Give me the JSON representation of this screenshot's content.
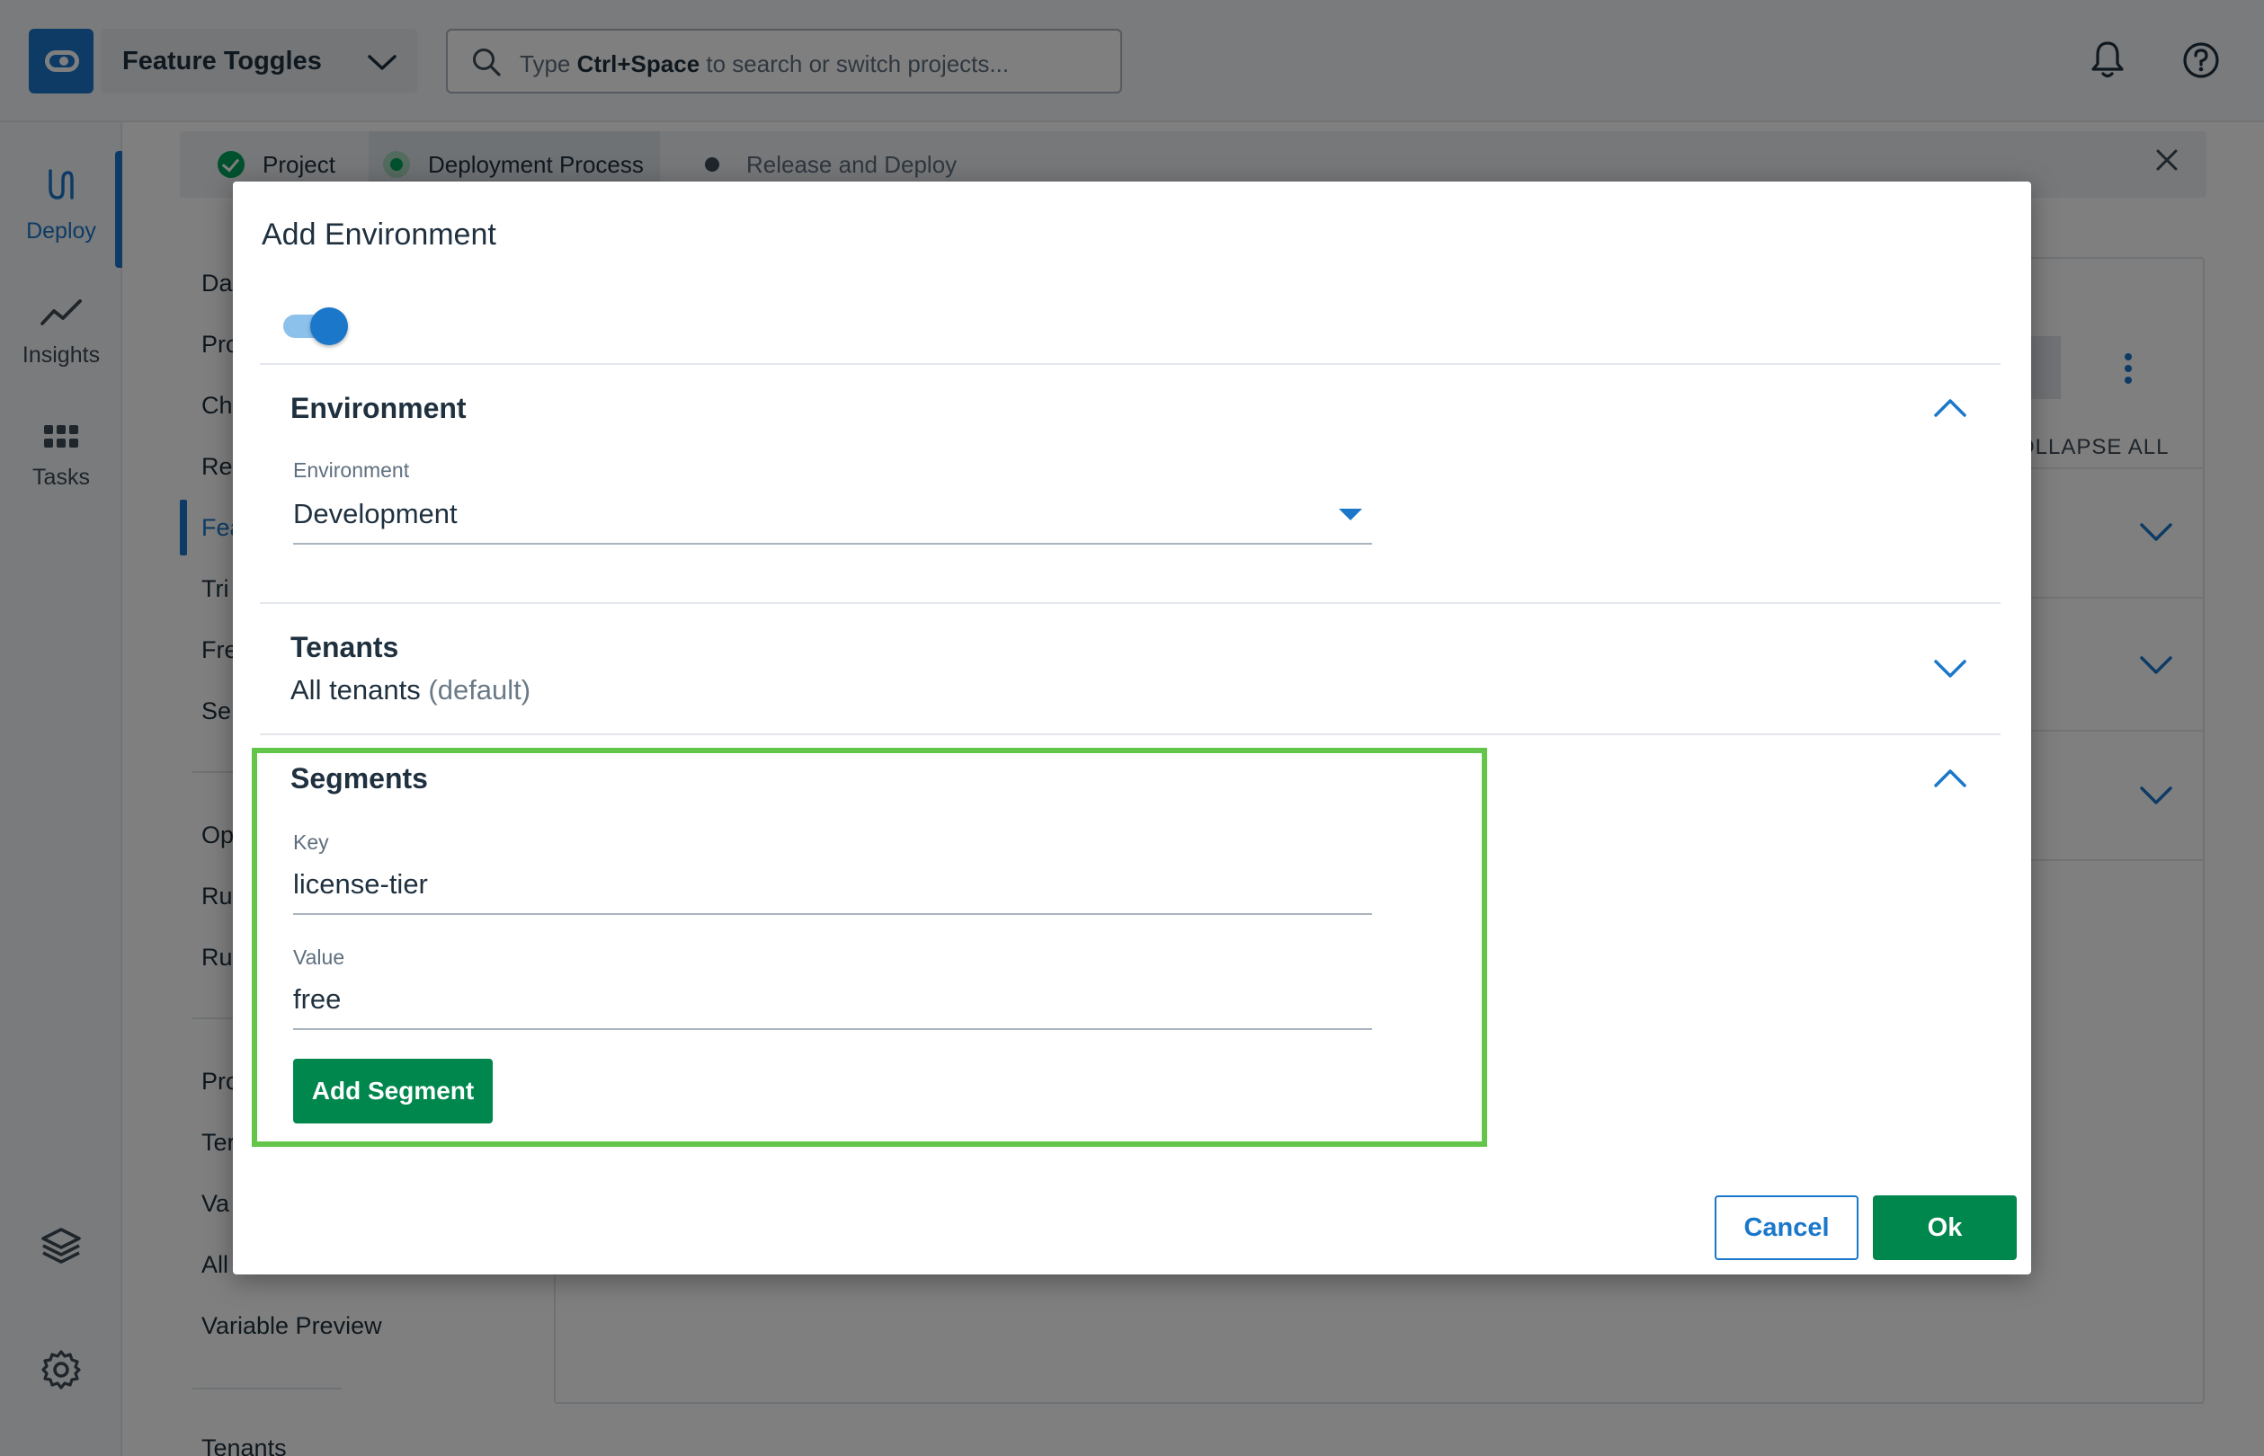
{
  "app": {
    "project_name": "Feature Toggles",
    "search": {
      "prefix": "Type ",
      "shortcut": "Ctrl+Space",
      "suffix": " to search or switch projects..."
    }
  },
  "leftnav": {
    "items": [
      {
        "label": "Deploy",
        "icon": "deploy-icon"
      },
      {
        "label": "Insights",
        "icon": "insights-icon"
      },
      {
        "label": "Tasks",
        "icon": "tasks-icon"
      }
    ],
    "bottom_icons": [
      "layers-icon",
      "gear-icon",
      "avatar"
    ]
  },
  "stepper": {
    "steps": [
      {
        "label": "Project",
        "state": "complete"
      },
      {
        "label": "Deployment Process",
        "state": "current"
      },
      {
        "label": "Release and Deploy",
        "state": "pending"
      }
    ]
  },
  "subnav": {
    "items": [
      "Da",
      "Pro",
      "Ch",
      "Re",
      "Fea",
      "Tri",
      "Fre",
      "Se",
      "Op",
      "Ru",
      "Ru",
      "Pro",
      "Ter",
      "Va",
      "All",
      "Variable Preview",
      "Tenants"
    ]
  },
  "background_panel": {
    "collapse_all": "OLLAPSE ALL"
  },
  "dialog": {
    "title": "Add Environment",
    "enabled": true,
    "environment_section": {
      "title": "Environment",
      "field_label": "Environment",
      "field_value": "Development",
      "expanded": true
    },
    "tenants_section": {
      "title": "Tenants",
      "value": "All tenants",
      "value_suffix": "(default)",
      "expanded": false
    },
    "segments_section": {
      "title": "Segments",
      "key_label": "Key",
      "key_value": "license-tier",
      "value_label": "Value",
      "value_value": "free",
      "add_button": "Add Segment",
      "expanded": true
    },
    "cancel_label": "Cancel",
    "ok_label": "Ok"
  },
  "colors": {
    "primary_blue": "#1a77ca",
    "primary_green": "#00874d",
    "highlight_green": "#63c64a",
    "overlay": "rgba(0,0,0,0.5)"
  }
}
